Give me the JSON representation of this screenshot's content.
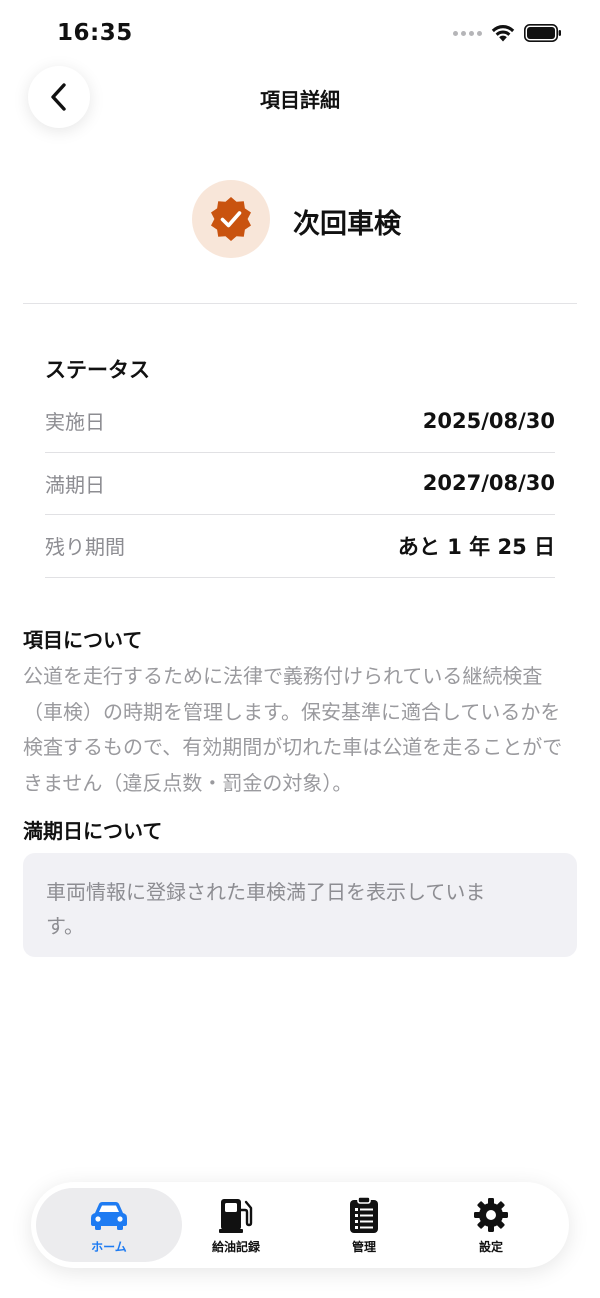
{
  "status_bar": {
    "time": "16:35"
  },
  "nav": {
    "title": "項目詳細"
  },
  "item": {
    "title": "次回車検",
    "accent_color": "#c9530f"
  },
  "status": {
    "heading": "ステータス",
    "rows": [
      {
        "label": "実施日",
        "value": "2025/08/30"
      },
      {
        "label": "満期日",
        "value": "2027/08/30"
      },
      {
        "label": "残り期間",
        "value": "あと 1 年 25 日"
      }
    ]
  },
  "about": {
    "heading": "項目について",
    "text": "公道を走行するために法律で義務付けられている継続検査（車検）の時期を管理します。保安基準に適合しているかを検査するもので、有効期間が切れた車は公道を走ることができません（違反点数・罰金の対象）。"
  },
  "expiry": {
    "heading": "満期日について",
    "note": "車両情報に登録された車検満了日を表示しています。"
  },
  "tabs": [
    {
      "label": "ホーム",
      "icon": "car-icon",
      "active": true
    },
    {
      "label": "給油記録",
      "icon": "fuel-pump-icon",
      "active": false
    },
    {
      "label": "管理",
      "icon": "clipboard-icon",
      "active": false
    },
    {
      "label": "設定",
      "icon": "gear-icon",
      "active": false
    }
  ],
  "colors": {
    "active_tab": "#1e7bf2"
  }
}
